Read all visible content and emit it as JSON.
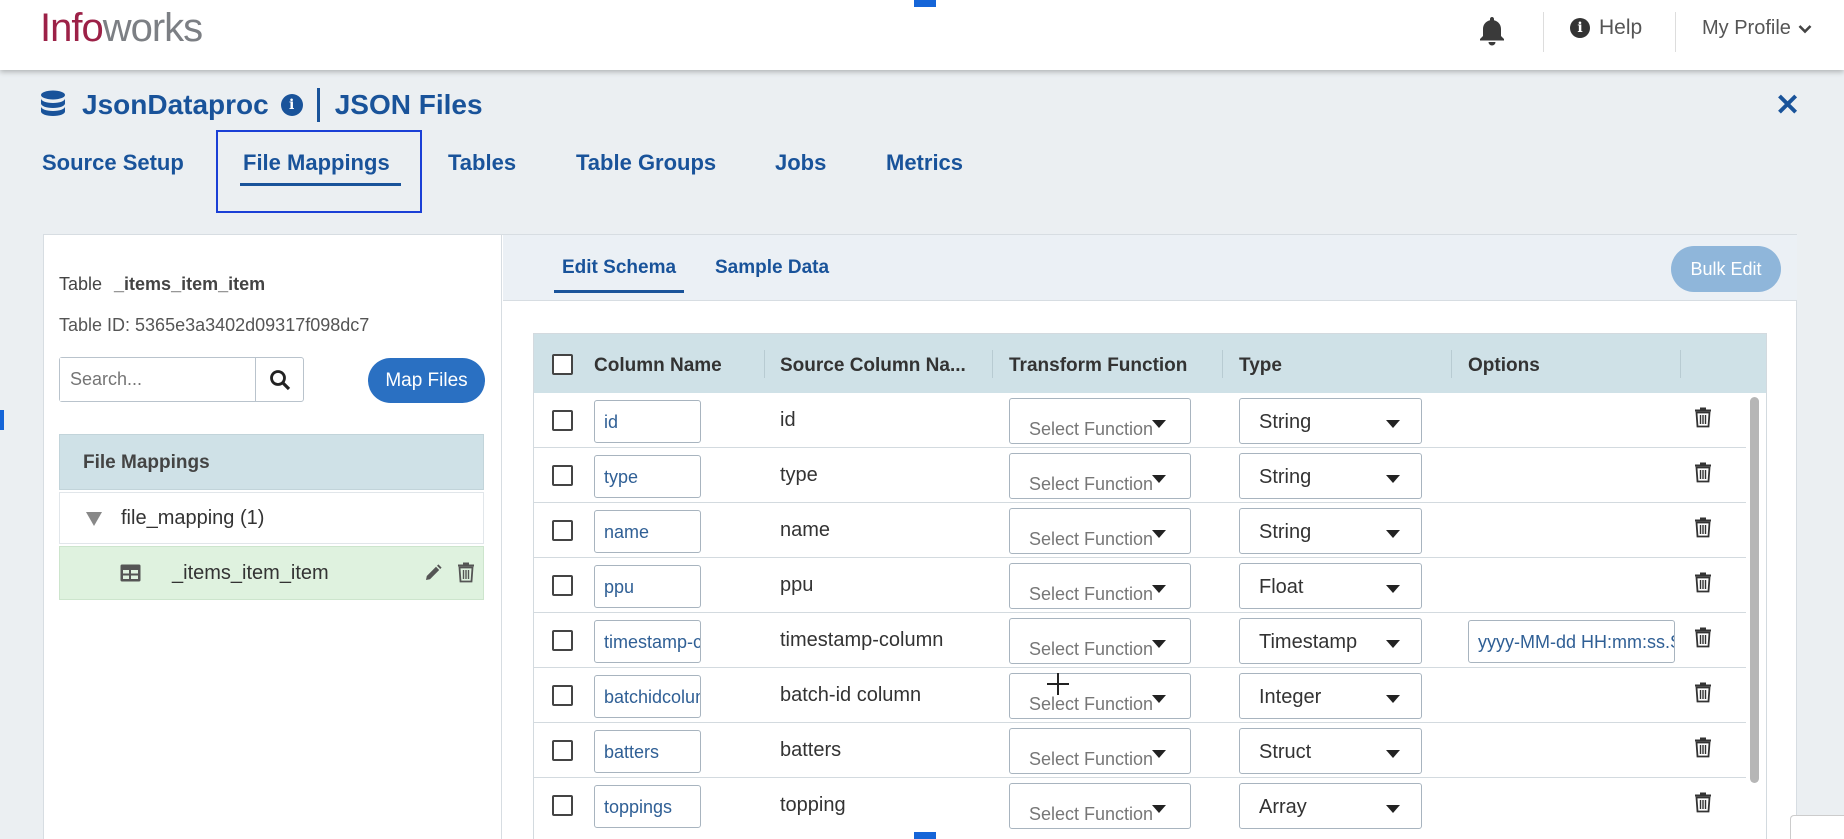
{
  "header": {
    "logo_part1": "Info",
    "logo_part2": "works",
    "notification_icon": "bell-icon",
    "help_label": "Help",
    "profile_label": "My Profile"
  },
  "source": {
    "name": "JsonDataproc",
    "type_label": "JSON Files",
    "tabs": [
      "Source Setup",
      "File Mappings",
      "Tables",
      "Table Groups",
      "Jobs",
      "Metrics"
    ],
    "active_tab": "File Mappings"
  },
  "left_panel": {
    "table_label": "Table",
    "table_name": "_items_item_item",
    "table_id_text": "Table ID: 5365e3a3402d09317f098dc7",
    "search_placeholder": "Search...",
    "map_files_button": "Map Files",
    "file_mappings_header": "File Mappings",
    "file_mapping_node": "file_mapping (1)",
    "selected_table": "_items_item_item"
  },
  "schema": {
    "subtabs": [
      "Edit Schema",
      "Sample Data"
    ],
    "active_subtab": "Edit Schema",
    "bulk_edit_button": "Bulk Edit",
    "columns_header": [
      "Column Name",
      "Source Column Na...",
      "Transform Function",
      "Type",
      "Options"
    ],
    "function_placeholder": "Select Function",
    "rows": [
      {
        "name": "id",
        "source": "id",
        "type": "String",
        "options": ""
      },
      {
        "name": "type",
        "source": "type",
        "type": "String",
        "options": ""
      },
      {
        "name": "name",
        "source": "name",
        "type": "String",
        "options": ""
      },
      {
        "name": "ppu",
        "source": "ppu",
        "type": "Float",
        "options": ""
      },
      {
        "name": "timestamp-column",
        "source": "timestamp-column",
        "type": "Timestamp",
        "options": "yyyy-MM-dd HH:mm:ss.SSS"
      },
      {
        "name": "batchidcolumn",
        "source": "batch-id column",
        "type": "Integer",
        "options": ""
      },
      {
        "name": "batters",
        "source": "batters",
        "type": "Struct",
        "options": ""
      },
      {
        "name": "toppings",
        "source": "topping",
        "type": "Array",
        "options": ""
      }
    ]
  },
  "colors": {
    "brand_red": "#9c2147",
    "primary_blue": "#19539a",
    "button_blue": "#2a70c2",
    "header_teal": "#cfe1e7",
    "selected_green": "#dff2df"
  }
}
